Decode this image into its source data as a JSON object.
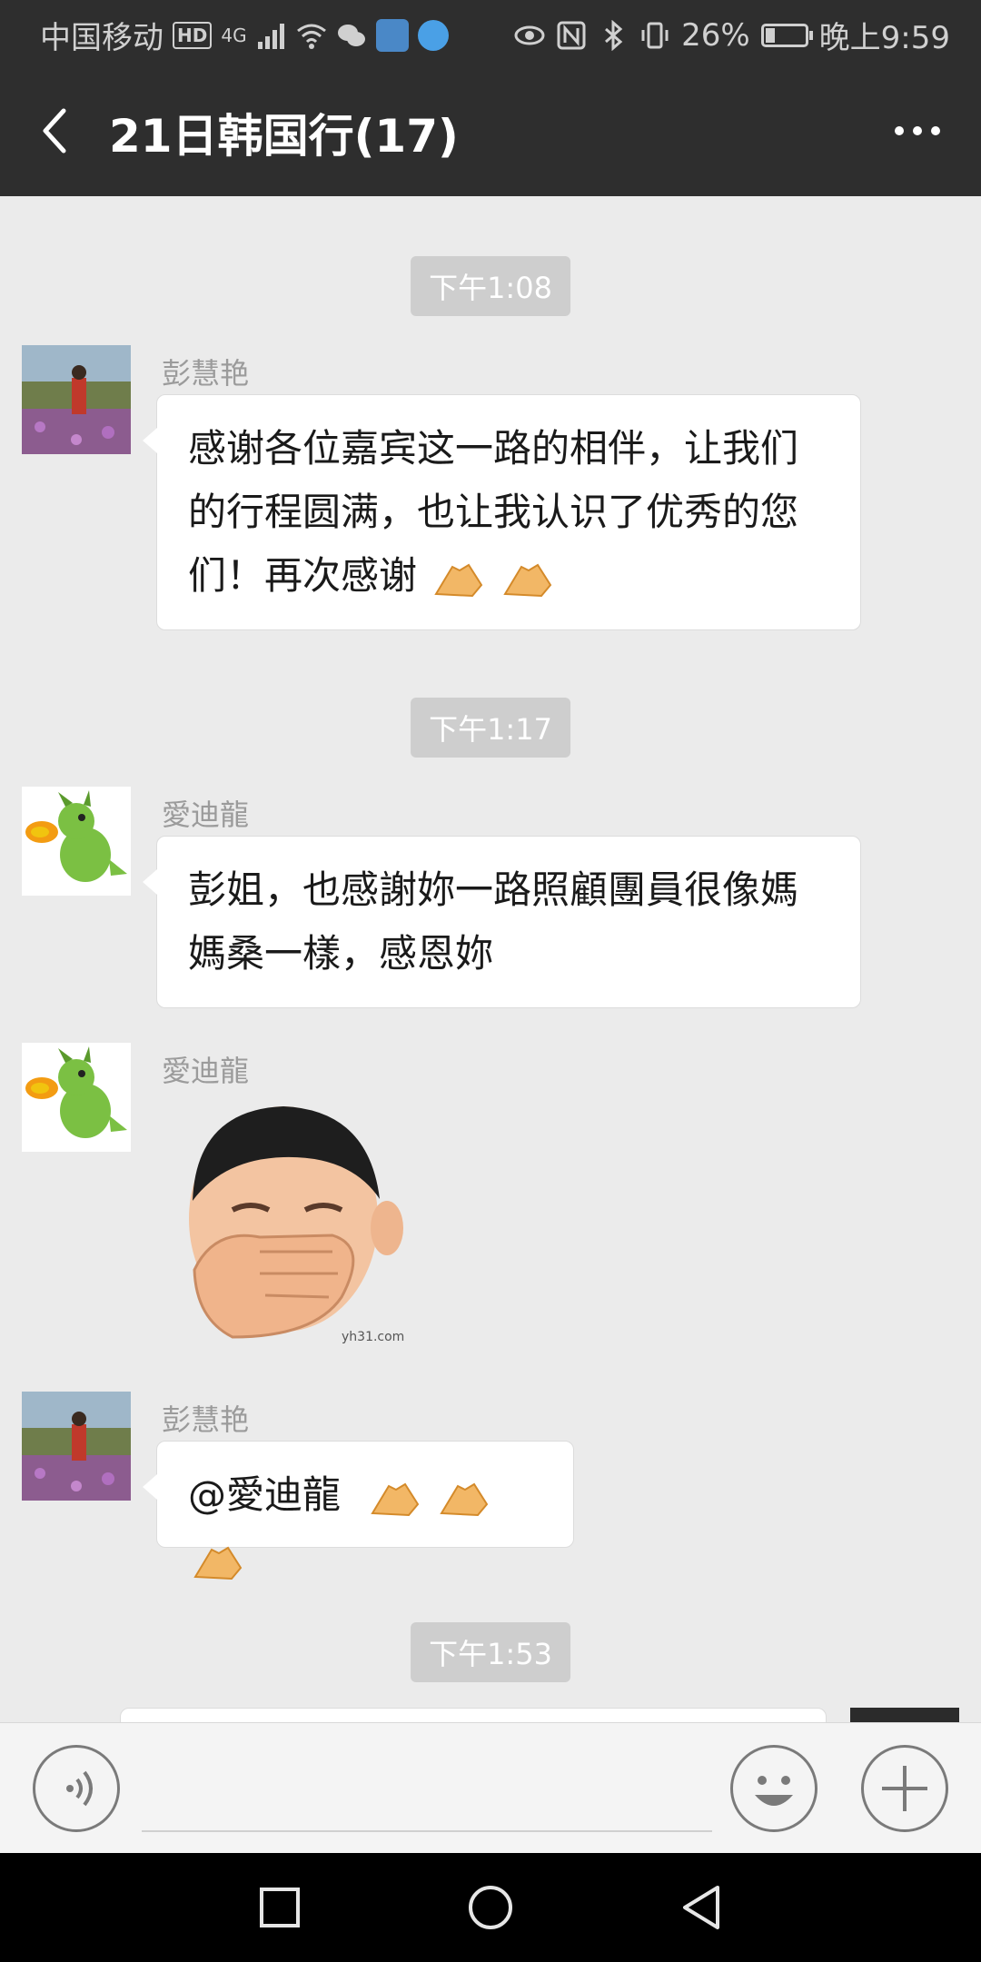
{
  "status_bar": {
    "carrier": "中国移动",
    "hd_label": "HD",
    "network": "4G",
    "battery_pct": "26%",
    "time": "晚上9:59"
  },
  "header": {
    "title": "21日韩国行(17)"
  },
  "messages": [
    {
      "type": "timestamp",
      "text": "下午1:08"
    },
    {
      "type": "text",
      "sender": "彭慧艳",
      "text": "感谢各位嘉宾这一路的相伴，让我们的行程圆满，也让我认识了优秀的您们！再次感谢"
    },
    {
      "type": "timestamp",
      "text": "下午1:17"
    },
    {
      "type": "text",
      "sender": "愛迪龍",
      "text": "彭姐，也感謝妳一路照顧團員很像媽媽桑一樣，感恩妳"
    },
    {
      "type": "sticker",
      "sender": "愛迪龍",
      "watermark": "yh31.com"
    },
    {
      "type": "text",
      "sender": "彭慧艳",
      "text": "@愛迪龍"
    },
    {
      "type": "timestamp",
      "text": "下午1:53"
    }
  ],
  "input": {
    "placeholder": ""
  }
}
